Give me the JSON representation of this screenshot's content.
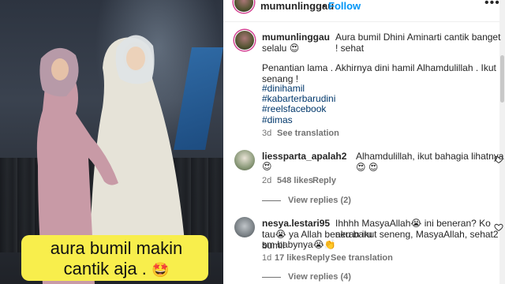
{
  "media": {
    "caption_line1": "aura bumil makin",
    "caption_line2": "cantik aja .",
    "caption_emoji": "🤩"
  },
  "header": {
    "username": "mumunlinggau",
    "separator": "•",
    "follow_label": "Follow",
    "more_label": "•••"
  },
  "post": {
    "username": "mumunlinggau",
    "text_line1": "Aura bumil Dhini Aminarti cantik banget ! sehat",
    "text_line2": "selalu 😍",
    "text_line3": "Penantian lama . Akhirnya dini hamil Alhamdulillah . Ikut senang !",
    "hashtags": [
      "#dinihamil",
      "#kabarterbarudini",
      "#reelsfacebook",
      "#dimas"
    ],
    "time": "3d",
    "see_translation": "See translation"
  },
  "comments": [
    {
      "username": "liessparta_apalah2",
      "text_line1": "Alhamdulillah, ikut bahagia lihatnya 😍 😍",
      "text_line2": "😍",
      "time": "2d",
      "likes": "548 likes",
      "reply": "Reply",
      "view_replies": "View replies (2)"
    },
    {
      "username": "nesya.lestari95",
      "text_line1": "Ihhhh MasyaAllah😭 ini beneran? Ko aku baru",
      "text_line2": "tau😭 ya Allah beneran ikut seneng, MasyaAllah, sehat2 bumil",
      "text_line3": "sm babynya😭👏",
      "time": "1d",
      "likes": "17 likes",
      "reply": "Reply",
      "see_translation": "See translation",
      "view_replies": "View replies (4)"
    }
  ],
  "colors": {
    "link": "#0095f6",
    "hashtag": "#00376b",
    "caption_bg": "#f8ee4c",
    "muted": "#737373"
  }
}
